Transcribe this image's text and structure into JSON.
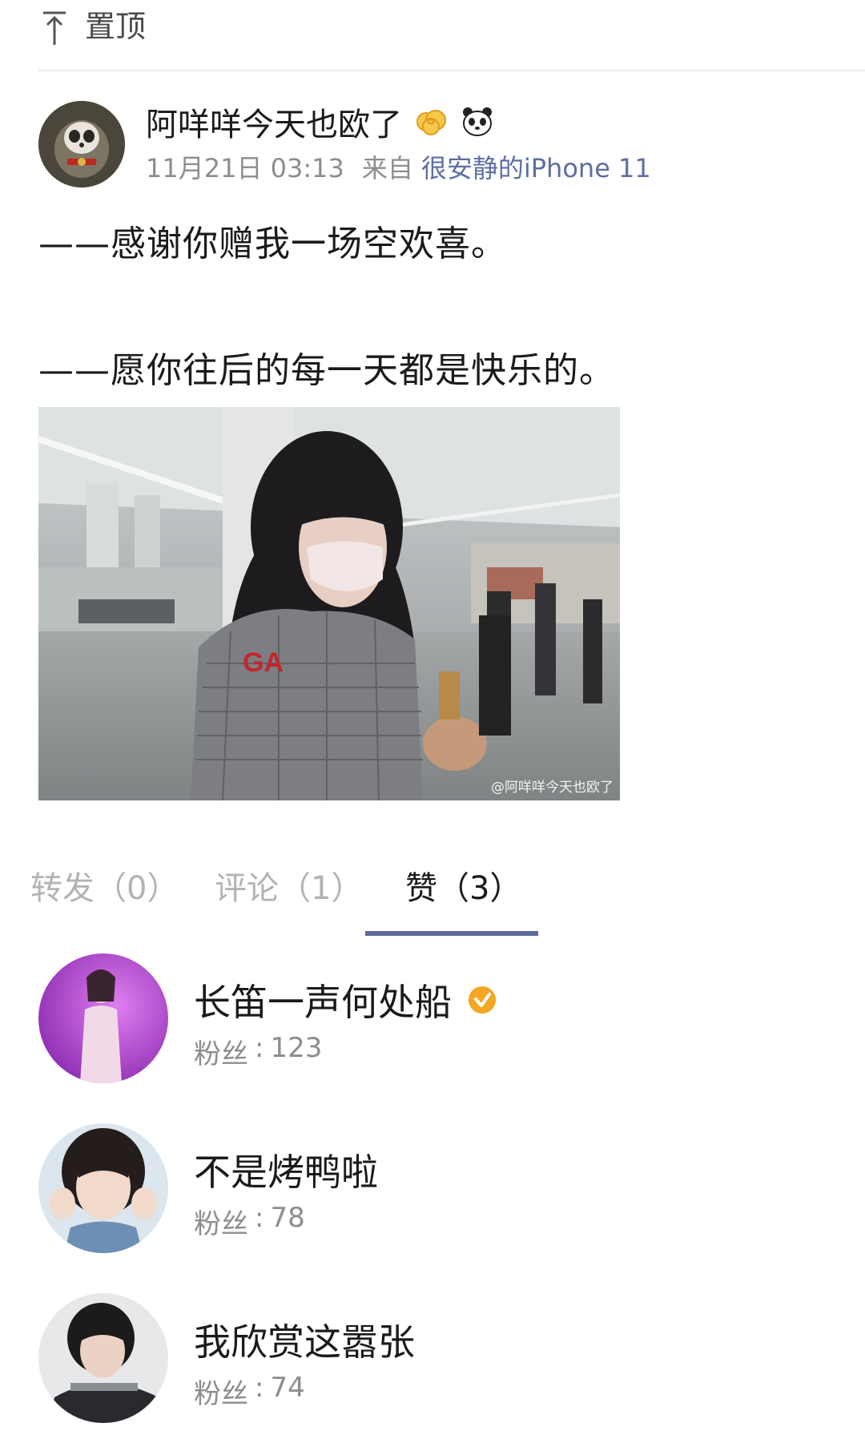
{
  "header": {
    "pin_icon": "pin-to-top-icon",
    "pin_label": "置顶"
  },
  "post": {
    "author": {
      "name": "阿咩咩今天也欧了",
      "avatar_icon": "raccoon-avatar",
      "badges": [
        "golden-cloud-emoji-icon",
        "panda-emoji-icon"
      ]
    },
    "timestamp": "11月21日 03:13",
    "source_prefix": "来自",
    "device": "很安静的iPhone 11",
    "lines": [
      "——感谢你赠我一场空欢喜。",
      "——愿你往后的每一天都是快乐的。"
    ],
    "image_watermark": "@阿咩咩今天也欧了"
  },
  "tabs": {
    "repost": "转发（0）",
    "comments": "评论（1）",
    "likes": "赞（3）",
    "active": "likes"
  },
  "likers": [
    {
      "name": "长笛一声何处船",
      "verified": true,
      "fans_label": "粉丝",
      "fans": "123"
    },
    {
      "name": "不是烤鸭啦",
      "verified": false,
      "fans_label": "粉丝",
      "fans": "78"
    },
    {
      "name": "我欣赏这嚣张",
      "verified": false,
      "fans_label": "粉丝",
      "fans": "74"
    }
  ],
  "colors": {
    "link": "#5e6ea3",
    "tab_underline": "#5f6a9a",
    "muted": "#8d8d8d",
    "verified": "#f5a623"
  }
}
